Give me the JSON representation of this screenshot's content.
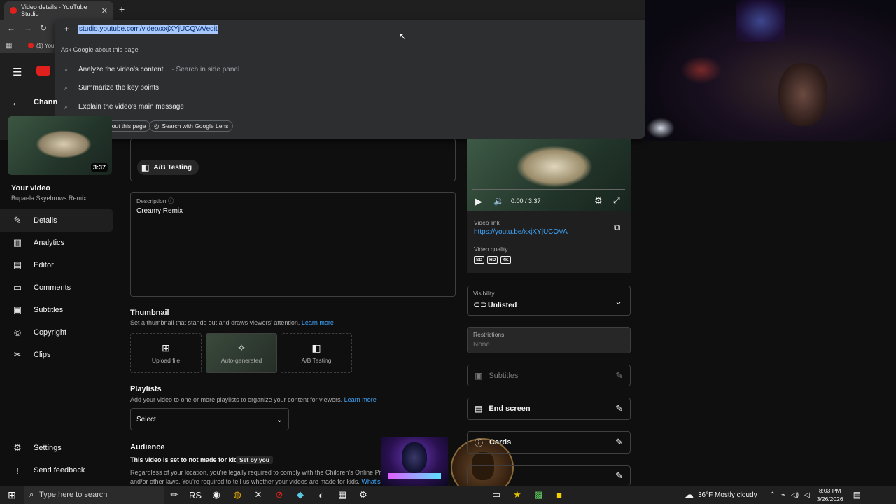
{
  "browser": {
    "tab_title": "Video details - YouTube Studio",
    "url": "studio.youtube.com/video/xxjXYjUCQVA/edit",
    "bookmark_label": "(1) You"
  },
  "omnibox": {
    "section_header": "Ask Google about this page",
    "suggestions": [
      {
        "text": "Analyze the video's content",
        "hint": "Search in side panel"
      },
      {
        "text": "Summarize the key points",
        "hint": ""
      },
      {
        "text": "Explain the video's main message",
        "hint": ""
      }
    ],
    "chips": [
      "Ask Google about this page",
      "Search with Google Lens"
    ]
  },
  "studio": {
    "channel_label": "Chann",
    "video_duration": "3:37",
    "your_video_label": "Your video",
    "video_title": "Bupaela Skyebrows Remix",
    "nav": [
      {
        "label": "Details",
        "icon": "pencil-icon"
      },
      {
        "label": "Analytics",
        "icon": "chart-icon"
      },
      {
        "label": "Editor",
        "icon": "film-icon"
      },
      {
        "label": "Comments",
        "icon": "comment-icon"
      },
      {
        "label": "Subtitles",
        "icon": "subtitles-icon"
      },
      {
        "label": "Copyright",
        "icon": "copyright-icon"
      },
      {
        "label": "Clips",
        "icon": "scissors-icon"
      }
    ],
    "settings_label": "Settings",
    "feedback_label": "Send feedback"
  },
  "details": {
    "ab_testing_label": "A/B Testing",
    "description_label": "Description",
    "description_value": "Creamy Remix",
    "thumbnail_heading": "Thumbnail",
    "thumbnail_sub": "Set a thumbnail that stands out and draws viewers' attention.",
    "learn_more": "Learn more",
    "thumb_options": [
      "Upload file",
      "Auto-generated",
      "A/B Testing"
    ],
    "playlists_heading": "Playlists",
    "playlists_sub": "Add your video to one or more playlists to organize your content for viewers.",
    "playlist_select": "Select",
    "audience_heading": "Audience",
    "audience_status": "This video is set to not made for kids",
    "set_by_you": "Set by you",
    "audience_legal_1": "Regardless of your location, you're legally required to comply with the Children's Online Privac",
    "audience_legal_2": "and/or other laws. You're required to tell us whether your videos are made for kids.",
    "whats_co": "What's co"
  },
  "side": {
    "player_time": "0:00 / 3:37",
    "video_link_label": "Video link",
    "video_link": "https://youtu.be/xxjXYjUCQVA",
    "video_quality_label": "Video quality",
    "qualities": [
      "SD",
      "HD",
      "4K"
    ],
    "visibility_label": "Visibility",
    "visibility_value": "Unlisted",
    "restrictions_label": "Restrictions",
    "restrictions_value": "None",
    "subtitles_label": "Subtitles",
    "end_screen_label": "End screen",
    "cards_label": "Cards"
  },
  "taskbar": {
    "search_placeholder": "Type here to search",
    "weather": "36°F  Mostly cloudy",
    "time": "8:03 PM",
    "date": "3/26/2026"
  }
}
